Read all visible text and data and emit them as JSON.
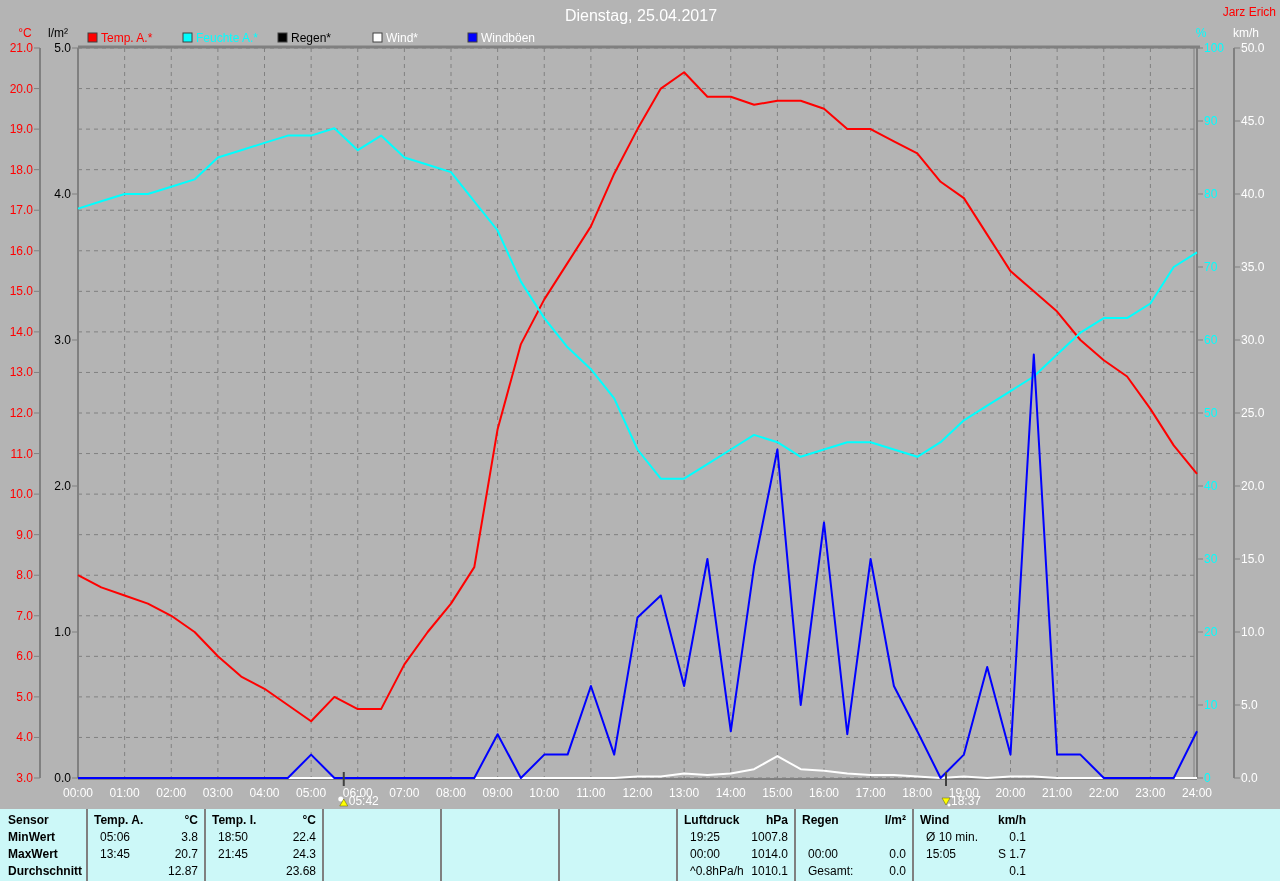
{
  "author": "Jarz Erich",
  "climate_chart": {
    "chart_data": {
      "type": "line",
      "title": "Dienstag, 25.04.2017",
      "x": [
        0,
        0.5,
        1,
        1.5,
        2,
        2.5,
        3,
        3.5,
        4,
        4.5,
        5,
        5.5,
        6,
        6.5,
        7,
        7.5,
        8,
        8.5,
        9,
        9.5,
        10,
        10.5,
        11,
        11.5,
        12,
        12.5,
        13,
        13.5,
        14,
        14.5,
        15,
        15.5,
        16,
        16.5,
        17,
        17.5,
        18,
        18.5,
        19,
        19.5,
        20,
        20.5,
        21,
        21.5,
        22,
        22.5,
        23,
        23.5,
        24
      ],
      "xlim": [
        0,
        24
      ],
      "xticks": [
        {
          "value": 0,
          "label": "00:00"
        },
        {
          "value": 1,
          "label": "01:00"
        },
        {
          "value": 2,
          "label": "02:00"
        },
        {
          "value": 3,
          "label": "03:00"
        },
        {
          "value": 4,
          "label": "04:00"
        },
        {
          "value": 5,
          "label": "05:00"
        },
        {
          "value": 6,
          "label": "06:00"
        },
        {
          "value": 7,
          "label": "07:00"
        },
        {
          "value": 8,
          "label": "08:00"
        },
        {
          "value": 9,
          "label": "09:00"
        },
        {
          "value": 10,
          "label": "10:00"
        },
        {
          "value": 11,
          "label": "11:00"
        },
        {
          "value": 12,
          "label": "12:00"
        },
        {
          "value": 13,
          "label": "13:00"
        },
        {
          "value": 14,
          "label": "14:00"
        },
        {
          "value": 15,
          "label": "15:00"
        },
        {
          "value": 16,
          "label": "16:00"
        },
        {
          "value": 17,
          "label": "17:00"
        },
        {
          "value": 18,
          "label": "18:00"
        },
        {
          "value": 19,
          "label": "19:00"
        },
        {
          "value": 20,
          "label": "20:00"
        },
        {
          "value": 21,
          "label": "21:00"
        },
        {
          "value": 22,
          "label": "22:00"
        },
        {
          "value": 23,
          "label": "23:00"
        },
        {
          "value": 24,
          "label": "24:00"
        }
      ],
      "ylabel": "°C",
      "ylim": [
        3,
        21
      ],
      "yticks": [
        {
          "value": 3,
          "label": "3.0"
        },
        {
          "value": 4,
          "label": "4.0"
        },
        {
          "value": 5,
          "label": "5.0"
        },
        {
          "value": 6,
          "label": "6.0"
        },
        {
          "value": 7,
          "label": "7.0"
        },
        {
          "value": 8,
          "label": "8.0"
        },
        {
          "value": 9,
          "label": "9.0"
        },
        {
          "value": 10,
          "label": "10.0"
        },
        {
          "value": 11,
          "label": "11.0"
        },
        {
          "value": 12,
          "label": "12.0"
        },
        {
          "value": 13,
          "label": "13.0"
        },
        {
          "value": 14,
          "label": "14.0"
        },
        {
          "value": 15,
          "label": "15.0"
        },
        {
          "value": 16,
          "label": "16.0"
        },
        {
          "value": 17,
          "label": "17.0"
        },
        {
          "value": 18,
          "label": "18.0"
        },
        {
          "value": 19,
          "label": "19.0"
        },
        {
          "value": 20,
          "label": "20.0"
        },
        {
          "value": 21,
          "label": "21.0"
        }
      ],
      "y2label": "l/m²",
      "y2lim": [
        0,
        5
      ],
      "y2ticks": [
        {
          "value": 0,
          "label": "0.0"
        },
        {
          "value": 1,
          "label": "1.0"
        },
        {
          "value": 2,
          "label": "2.0"
        },
        {
          "value": 3,
          "label": "3.0"
        },
        {
          "value": 4,
          "label": "4.0"
        },
        {
          "value": 5,
          "label": "5.0"
        }
      ],
      "y3label": "%",
      "y3lim": [
        0,
        100
      ],
      "y3ticks": [
        {
          "value": 0,
          "label": "0"
        },
        {
          "value": 10,
          "label": "10"
        },
        {
          "value": 20,
          "label": "20"
        },
        {
          "value": 30,
          "label": "30"
        },
        {
          "value": 40,
          "label": "40"
        },
        {
          "value": 50,
          "label": "50"
        },
        {
          "value": 60,
          "label": "60"
        },
        {
          "value": 70,
          "label": "70"
        },
        {
          "value": 80,
          "label": "80"
        },
        {
          "value": 90,
          "label": "90"
        },
        {
          "value": 100,
          "label": "100"
        }
      ],
      "series": [
        {
          "name": "Temp. A.*",
          "color": "#ff0000",
          "values": [
            8.0,
            7.7,
            7.5,
            7.3,
            7.0,
            6.6,
            6.0,
            5.5,
            5.2,
            4.8,
            4.4,
            5.0,
            4.7,
            4.7,
            5.8,
            6.6,
            7.3,
            8.2,
            11.6,
            13.7,
            14.8,
            15.7,
            16.6,
            17.9,
            19.0,
            20.0,
            20.4,
            19.8,
            19.8,
            19.6,
            19.7,
            19.7,
            19.5,
            19.0,
            19.0,
            18.7,
            18.4,
            17.7,
            17.3,
            16.4,
            15.5,
            15.0,
            14.5,
            13.8,
            13.3,
            12.9,
            12.1,
            11.2,
            10.5
          ]
        },
        {
          "name": "Feuchte A.*",
          "color": "#00ffff",
          "axis": "y3",
          "values": [
            78,
            79,
            80,
            80,
            81,
            82,
            85,
            86,
            87,
            88,
            88,
            89,
            86,
            88,
            85,
            84,
            83,
            79,
            75,
            68,
            63,
            59,
            56,
            52,
            45,
            41,
            41,
            43,
            45,
            47,
            46,
            44,
            45,
            46,
            46,
            45,
            44,
            46,
            49,
            51,
            53,
            55,
            58,
            61,
            63,
            63,
            65,
            70,
            72
          ]
        },
        {
          "name": "Regen*",
          "color": "#000000",
          "axis": "y2",
          "values": [
            null,
            null,
            null,
            null,
            null,
            null,
            null,
            null,
            null,
            null,
            null,
            null,
            null,
            null,
            null,
            null,
            null,
            null,
            null,
            null,
            null,
            null,
            null,
            null,
            null,
            null,
            null,
            null,
            null,
            null,
            null,
            null,
            null,
            null,
            null,
            null,
            null,
            null,
            null,
            null,
            null,
            null,
            null,
            null,
            null,
            null,
            null,
            null,
            null
          ]
        }
      ],
      "legend": "top"
    }
  },
  "wind_chart": {
    "chart_data": {
      "type": "line",
      "x": [
        0,
        0.5,
        1,
        1.5,
        2,
        2.5,
        3,
        3.5,
        4,
        4.5,
        5,
        5.5,
        6,
        6.5,
        7,
        7.5,
        8,
        8.5,
        9,
        9.5,
        10,
        10.5,
        11,
        11.5,
        12,
        12.5,
        13,
        13.5,
        14,
        14.5,
        15,
        15.5,
        16,
        16.5,
        17,
        17.5,
        18,
        18.5,
        19,
        19.5,
        20,
        20.5,
        21,
        21.5,
        22,
        22.5,
        23,
        23.5,
        24
      ],
      "xlim": [
        0,
        24
      ],
      "ylabel": "km/h",
      "ylim": [
        0,
        50
      ],
      "yticks": [
        {
          "value": 0,
          "label": "0.0"
        },
        {
          "value": 5,
          "label": "5.0"
        },
        {
          "value": 10,
          "label": "10.0"
        },
        {
          "value": 15,
          "label": "15.0"
        },
        {
          "value": 20,
          "label": "20.0"
        },
        {
          "value": 25,
          "label": "25.0"
        },
        {
          "value": 30,
          "label": "30.0"
        },
        {
          "value": 35,
          "label": "35.0"
        },
        {
          "value": 40,
          "label": "40.0"
        },
        {
          "value": 45,
          "label": "45.0"
        },
        {
          "value": 50,
          "label": "50.0"
        }
      ],
      "series": [
        {
          "name": "Wind*",
          "color": "#ffffff",
          "values": [
            null,
            null,
            null,
            null,
            null,
            null,
            null,
            null,
            0,
            0,
            0,
            0,
            0,
            0,
            0,
            0,
            0,
            0,
            0,
            0,
            0,
            0,
            0,
            0,
            0.1,
            0.1,
            0.3,
            0.2,
            0.3,
            0.6,
            1.5,
            0.6,
            0.5,
            0.3,
            0.2,
            0.2,
            0.1,
            0,
            0.1,
            0,
            0.1,
            0.1,
            0,
            0,
            0,
            0,
            0,
            0,
            0
          ]
        },
        {
          "name": "Windböen",
          "color": "#0000ff",
          "values": [
            0,
            0,
            0,
            0,
            0,
            0,
            0,
            0,
            0,
            0,
            1.6,
            0,
            0,
            0,
            0,
            0,
            0,
            0,
            3.0,
            0,
            1.6,
            1.6,
            6.3,
            1.6,
            11.0,
            12.5,
            6.3,
            15.0,
            3.2,
            14.5,
            22.5,
            5.0,
            17.5,
            3.0,
            15.0,
            6.3,
            3.2,
            0,
            1.6,
            7.6,
            1.6,
            29.0,
            1.6,
            1.6,
            0,
            0,
            0,
            0,
            3.2
          ]
        }
      ],
      "legend": "top"
    }
  },
  "sun_times": [
    {
      "kind": "sunrise",
      "time": "05:42"
    },
    {
      "kind": "sunset",
      "time": "18:37"
    }
  ],
  "summary_table": {
    "row_labels": [
      "Sensor",
      "MinWert",
      "MaxWert",
      "Durchschnitt"
    ],
    "groups": [
      {
        "kind": "sensor",
        "header": "Temp. A.",
        "unit": "°C",
        "rows": [
          {
            "time": "05:06",
            "value": "3.8"
          },
          {
            "time": "13:45",
            "value": "20.7"
          },
          {
            "value": "12.87"
          }
        ]
      },
      {
        "kind": "sensor",
        "header": "Temp. I.",
        "unit": "°C",
        "rows": [
          {
            "time": "18:50",
            "value": "22.4"
          },
          {
            "time": "21:45",
            "value": "24.3"
          },
          {
            "value": "23.68"
          }
        ]
      },
      {
        "kind": "blank"
      },
      {
        "kind": "blank"
      },
      {
        "kind": "blank"
      },
      {
        "kind": "sensor",
        "header": "Luftdruck",
        "unit": "hPa",
        "rows": [
          {
            "time": "19:25",
            "value": "1007.8"
          },
          {
            "time": "00:00",
            "value": "1014.0"
          },
          {
            "time": "^0.8hPa/h",
            "value": "1010.1"
          }
        ]
      },
      {
        "kind": "sensor",
        "header": "Regen",
        "unit": "l/m²",
        "rows": [
          null,
          {
            "time": "00:00",
            "value": "0.0"
          },
          {
            "time": "Gesamt:",
            "value": "0.0"
          }
        ]
      },
      {
        "kind": "sensor",
        "header": "Wind",
        "unit": "km/h",
        "rows": [
          {
            "time": "Ø 10 min.",
            "value": "0.1"
          },
          {
            "time": "15:05",
            "value": "S 1.7"
          },
          {
            "value": "0.1"
          }
        ]
      }
    ]
  }
}
